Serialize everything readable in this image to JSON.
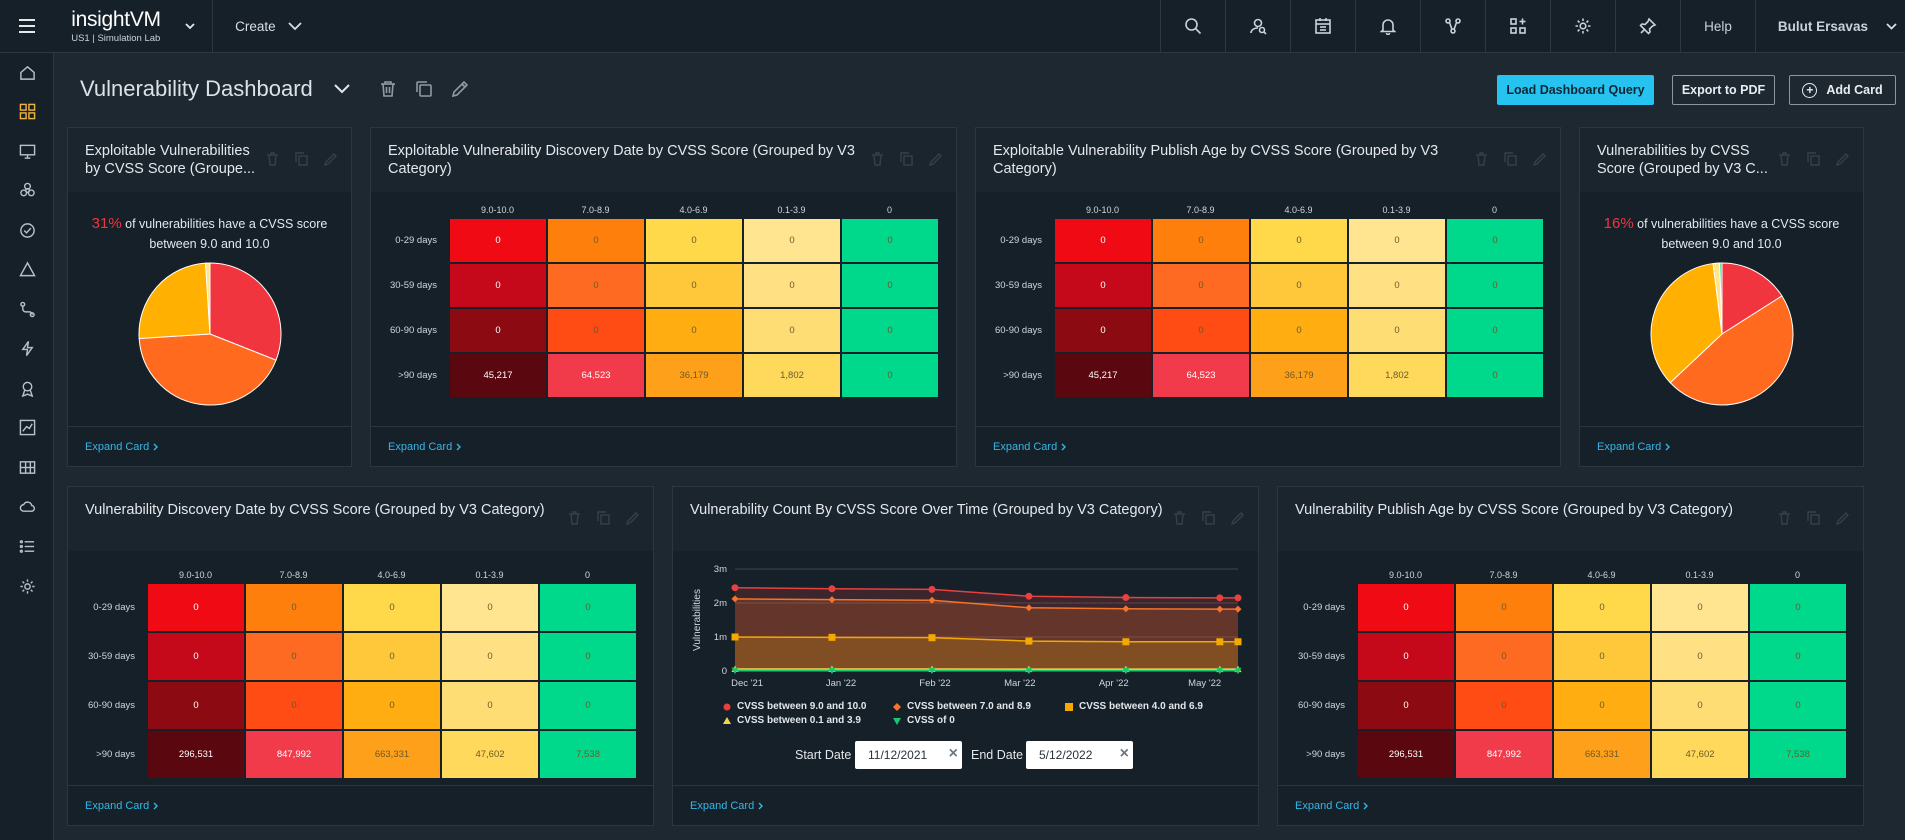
{
  "app": {
    "brand": "insightVM",
    "subtitle": "US1 | Simulation Lab",
    "create_label": "Create",
    "help_label": "Help",
    "user_name": "Bulut Ersavas"
  },
  "topbar_icons": [
    "search-icon",
    "asset-search-icon",
    "calendar-icon",
    "bell-icon",
    "network-icon",
    "add-widget-icon",
    "gear-icon",
    "pin-icon"
  ],
  "sidebar_icons": [
    "home-icon",
    "dashboard-icon",
    "monitor-icon",
    "biohazard-icon",
    "check-circle-icon",
    "warning-icon",
    "route-icon",
    "lightning-icon",
    "ribbon-icon",
    "chart-line-icon",
    "asset-grid-icon",
    "cloud-icon",
    "list-icon",
    "settings-icon"
  ],
  "page": {
    "title": "Vulnerability Dashboard"
  },
  "buttons": {
    "load": "Load Dashboard Query",
    "export": "Export to PDF",
    "add": "Add Card"
  },
  "expand_label": "Expand Card",
  "colors": {
    "accent": "#27c3f0",
    "critical": "#f0353e",
    "high": "#ff6a1e",
    "medium": "#ffb000",
    "low": "#ffd75a",
    "none": "#00d98b"
  },
  "cards": {
    "pie1": {
      "title": "Exploitable Vulnerabilities by CVSS Score (Groupe...",
      "pct": "31%",
      "text": "of vulnerabilities have a CVSS score between 9.0 and 10.0"
    },
    "hm1": {
      "title": "Exploitable Vulnerability Discovery Date by CVSS Score (Grouped by V3 Category)"
    },
    "hm2": {
      "title": "Exploitable Vulnerability Publish Age by CVSS Score (Grouped by V3 Category)"
    },
    "pie2": {
      "title": "Vulnerabilities by CVSS Score (Grouped by V3 C...",
      "pct": "16%",
      "text": "of vulnerabilities have a CVSS score between 9.0 and 10.0"
    },
    "hm3": {
      "title": "Vulnerability Discovery Date by CVSS Score (Grouped by V3 Category)"
    },
    "line": {
      "title": "Vulnerability Count By CVSS Score Over Time (Grouped by V3 Category)",
      "start_label": "Start Date",
      "start_value": "11/12/2021",
      "end_label": "End Date",
      "end_value": "5/12/2022"
    },
    "hm4": {
      "title": "Vulnerability Publish Age by CVSS Score (Grouped by V3 Category)"
    }
  },
  "heatmaps": {
    "columns": [
      "9.0-10.0",
      "7.0-8.9",
      "4.0-6.9",
      "0.1-3.9",
      "0"
    ],
    "rows": [
      "0-29 days",
      "30-59 days",
      "60-90 days",
      ">90 days"
    ],
    "exploitable_values": [
      [
        "0",
        "0",
        "0",
        "0",
        "0"
      ],
      [
        "0",
        "0",
        "0",
        "0",
        "0"
      ],
      [
        "0",
        "0",
        "0",
        "0",
        "0"
      ],
      [
        "45,217",
        "64,523",
        "36,179",
        "1,802",
        "0"
      ]
    ],
    "all_values": [
      [
        "0",
        "0",
        "0",
        "0",
        "0"
      ],
      [
        "0",
        "0",
        "0",
        "0",
        "0"
      ],
      [
        "0",
        "0",
        "0",
        "0",
        "0"
      ],
      [
        "296,531",
        "847,992",
        "663,331",
        "47,602",
        "7,538"
      ]
    ]
  },
  "pie_data": {
    "pie1": [
      {
        "label": "CVSS between 9.0 and 10.0",
        "value": 31,
        "color": "#f0353e"
      },
      {
        "label": "CVSS between 7.0 and 8.9",
        "value": 43,
        "color": "#ff6a1e"
      },
      {
        "label": "CVSS between 4.0 and 6.9",
        "value": 25,
        "color": "#ffb000"
      },
      {
        "label": "CVSS between 0.1 and 3.9",
        "value": 1,
        "color": "#ffe48a"
      }
    ],
    "pie2": [
      {
        "label": "CVSS between 9.0 and 10.0",
        "value": 16,
        "color": "#f0353e"
      },
      {
        "label": "CVSS between 7.0 and 8.9",
        "value": 47,
        "color": "#ff6a1e"
      },
      {
        "label": "CVSS between 4.0 and 6.9",
        "value": 35,
        "color": "#ffb000"
      },
      {
        "label": "CVSS between 0.1 and 3.9",
        "value": 1.5,
        "color": "#ffe48a"
      },
      {
        "label": "CVSS of 0",
        "value": 0.5,
        "color": "#00d98b"
      }
    ]
  },
  "chart_data": {
    "type": "line",
    "title": "Vulnerability Count By CVSS Score Over Time (Grouped by V3 Category)",
    "xlabel": "",
    "ylabel": "Vulnerabilities",
    "x_ticks": [
      "Dec '21",
      "Jan '22",
      "Feb '22",
      "Mar '22",
      "Apr '22",
      "May '22"
    ],
    "y_ticks": [
      "0",
      "1m",
      "2m",
      "3m"
    ],
    "ylim": [
      0,
      3000000
    ],
    "x": [
      "2021-11-27",
      "2021-12-29",
      "2022-01-31",
      "2022-03-04",
      "2022-04-05",
      "2022-05-06",
      "2022-05-12"
    ],
    "series": [
      {
        "name": "CVSS between 9.0 and 10.0",
        "color": "#e8403f",
        "marker": "circle",
        "values": [
          2450000,
          2420000,
          2400000,
          2200000,
          2160000,
          2150000,
          2150000
        ]
      },
      {
        "name": "CVSS between 7.0 and 8.9",
        "color": "#f5732a",
        "marker": "diamond",
        "values": [
          2120000,
          2100000,
          2080000,
          1860000,
          1830000,
          1820000,
          1820000
        ]
      },
      {
        "name": "CVSS between 4.0 and 6.9",
        "color": "#f5a900",
        "marker": "square",
        "values": [
          1000000,
          990000,
          980000,
          880000,
          860000,
          860000,
          860000
        ]
      },
      {
        "name": "CVSS between 0.1 and 3.9",
        "color": "#f1d54c",
        "marker": "triangle-up",
        "values": [
          60000,
          60000,
          60000,
          55000,
          55000,
          55000,
          55000
        ]
      },
      {
        "name": "CVSS of 0",
        "color": "#19c76e",
        "marker": "triangle-down",
        "values": [
          10000,
          10000,
          10000,
          9000,
          9000,
          9000,
          9000
        ]
      }
    ],
    "legend_position": "bottom",
    "grid": true
  }
}
